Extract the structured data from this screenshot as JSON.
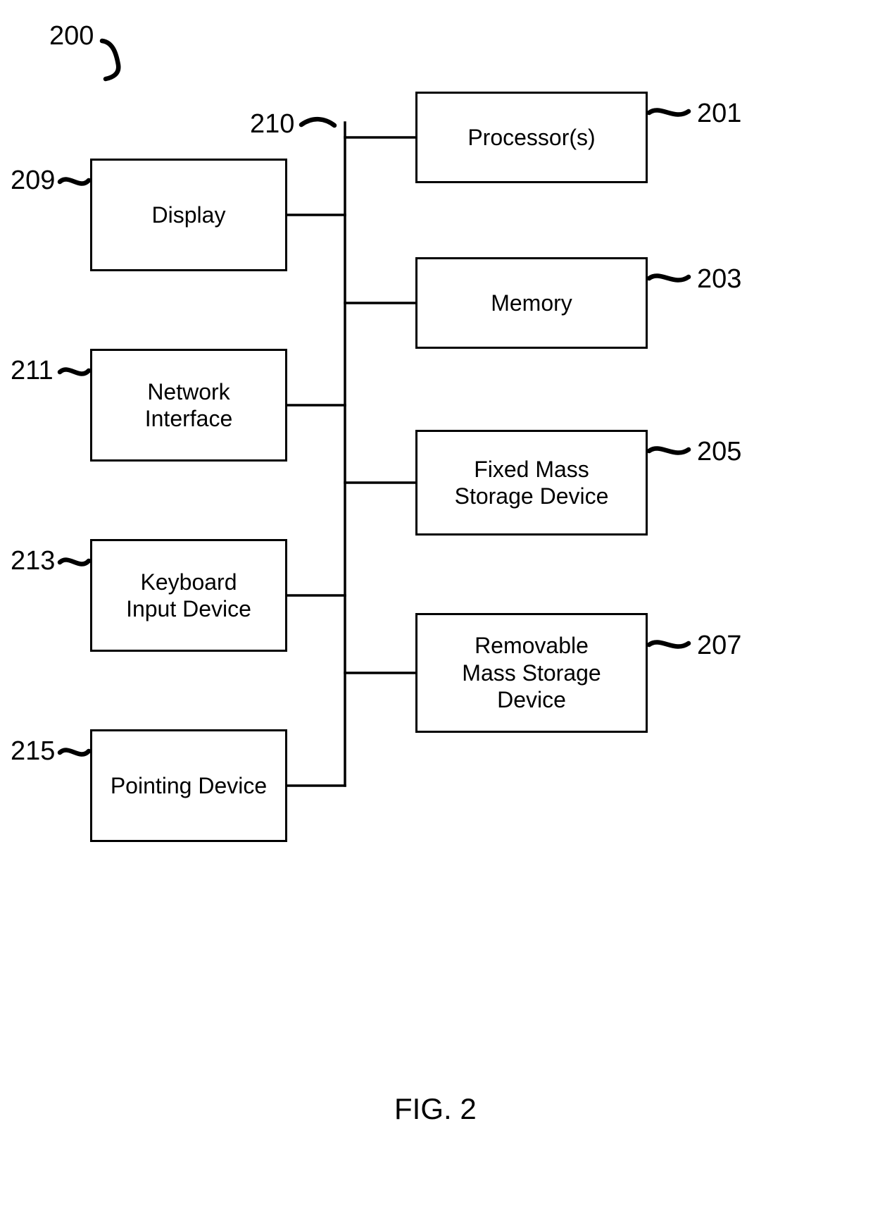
{
  "figure": {
    "number_label": "200",
    "caption": "FIG. 2",
    "bus_label": "210"
  },
  "blocks": {
    "processor": {
      "label": "Processor(s)",
      "ref": "201"
    },
    "memory": {
      "label": "Memory",
      "ref": "203"
    },
    "fixed": {
      "label": "Fixed Mass\nStorage Device",
      "ref": "205"
    },
    "removable": {
      "label": "Removable\nMass Storage\nDevice",
      "ref": "207"
    },
    "display": {
      "label": "Display",
      "ref": "209"
    },
    "network": {
      "label": "Network\nInterface",
      "ref": "211"
    },
    "keyboard": {
      "label": "Keyboard\nInput Device",
      "ref": "213"
    },
    "pointing": {
      "label": "Pointing Device",
      "ref": "215"
    }
  }
}
